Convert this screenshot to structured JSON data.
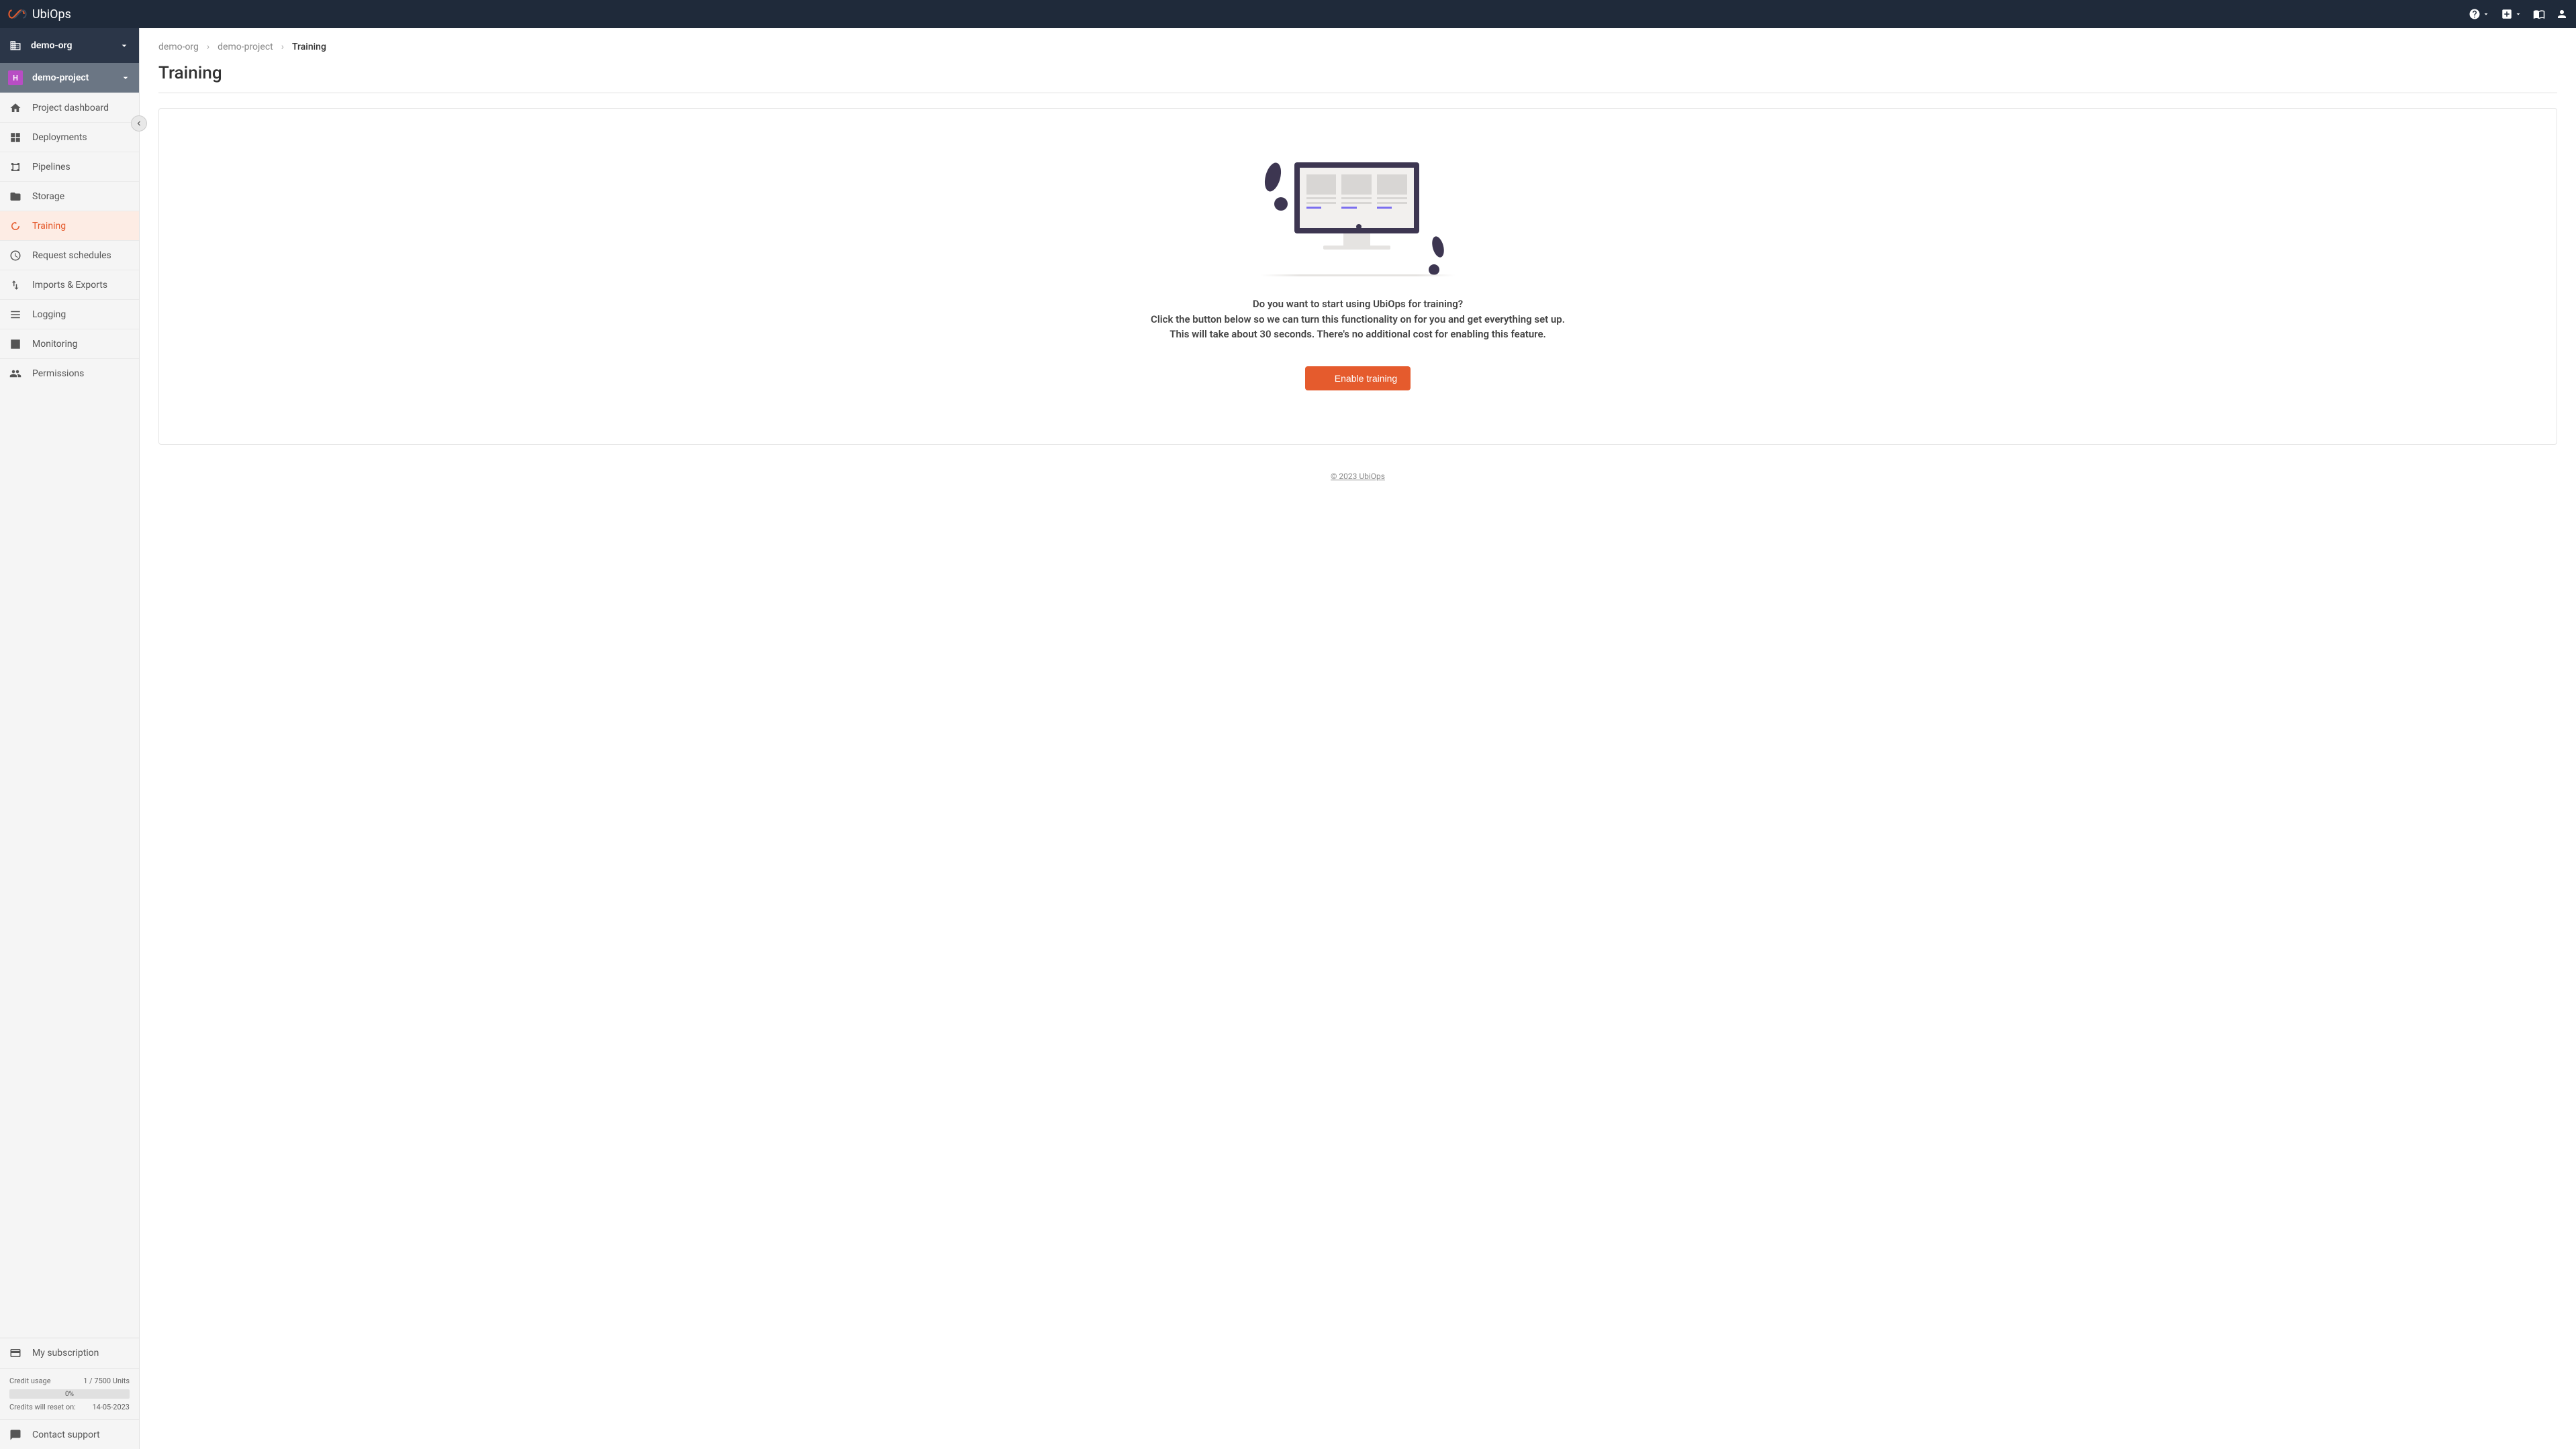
{
  "brand": "UbiOps",
  "org": {
    "name": "demo-org"
  },
  "project": {
    "name": "demo-project",
    "badge": "H"
  },
  "nav": {
    "dashboard": "Project dashboard",
    "deployments": "Deployments",
    "pipelines": "Pipelines",
    "storage": "Storage",
    "training": "Training",
    "schedules": "Request schedules",
    "imports": "Imports & Exports",
    "logging": "Logging",
    "monitoring": "Monitoring",
    "permissions": "Permissions"
  },
  "subscription": {
    "label": "My subscription",
    "credit_usage_label": "Credit usage",
    "credit_usage_value": "1 / 7500 Units",
    "usage_percent": "0%",
    "reset_label": "Credits will reset on:",
    "reset_date": "14-05-2023"
  },
  "support": {
    "label": "Contact support"
  },
  "breadcrumb": {
    "org": "demo-org",
    "project": "demo-project",
    "current": "Training"
  },
  "page": {
    "title": "Training",
    "line1": "Do you want to start using UbiOps for training?",
    "line2": "Click the button below so we can turn this functionality on for you and get everything set up.",
    "line3": "This will take about 30 seconds. There's no additional cost for enabling this feature.",
    "enable_btn": "Enable training"
  },
  "footer": "© 2023 UbiOps"
}
